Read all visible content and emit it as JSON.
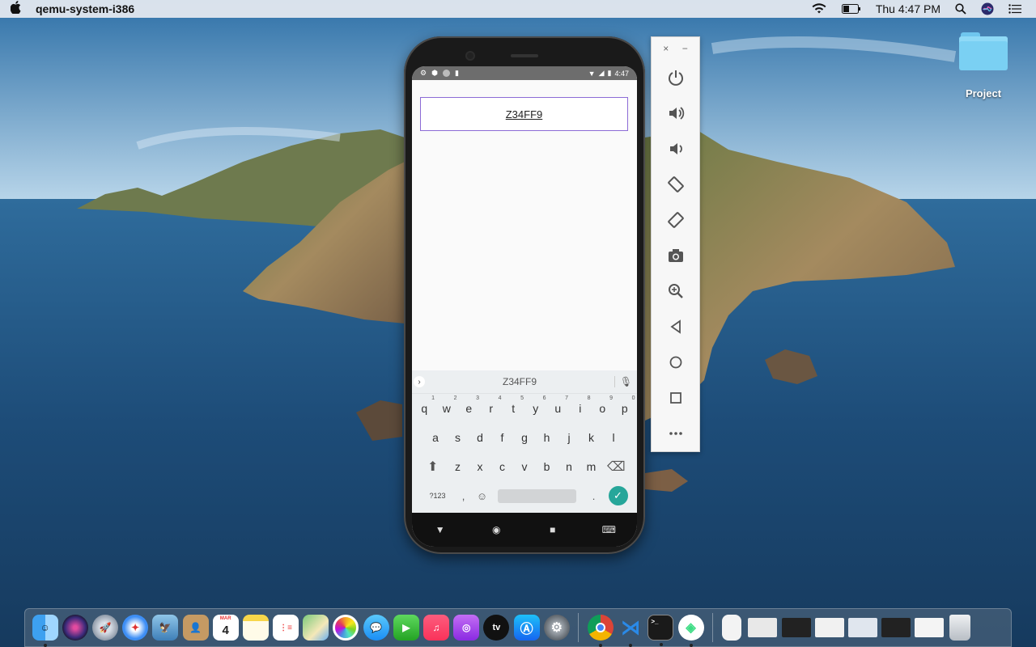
{
  "menubar": {
    "app_name": "qemu-system-i386",
    "clock": "Thu 4:47 PM",
    "icons": [
      "apple-icon",
      "wifi-icon",
      "battery-icon",
      "spotlight-search-icon",
      "siri-icon",
      "control-center-icon"
    ]
  },
  "desktop": {
    "folder_label": "Project"
  },
  "android": {
    "status_time": "4:47",
    "textbox_value": "Z34FF9",
    "suggestion": "Z34FF9",
    "keyboard": {
      "row1": [
        {
          "key": "q",
          "hint": "1"
        },
        {
          "key": "w",
          "hint": "2"
        },
        {
          "key": "e",
          "hint": "3"
        },
        {
          "key": "r",
          "hint": "4"
        },
        {
          "key": "t",
          "hint": "5"
        },
        {
          "key": "y",
          "hint": "6"
        },
        {
          "key": "u",
          "hint": "7"
        },
        {
          "key": "i",
          "hint": "8"
        },
        {
          "key": "o",
          "hint": "9"
        },
        {
          "key": "p",
          "hint": "0"
        }
      ],
      "row2": [
        "a",
        "s",
        "d",
        "f",
        "g",
        "h",
        "j",
        "k",
        "l"
      ],
      "row3": [
        "z",
        "x",
        "c",
        "v",
        "b",
        "n",
        "m"
      ],
      "symbols_label": "?123",
      "comma": ",",
      "period": "."
    },
    "navbar": {
      "back": "▼",
      "home": "◉",
      "recents": "■",
      "keyboard": "⌨"
    }
  },
  "emulator_toolbar": {
    "close": "×",
    "minimize": "−",
    "buttons": [
      "power",
      "volume-up",
      "volume-down",
      "rotate-left",
      "rotate-right",
      "screenshot",
      "zoom",
      "back",
      "home",
      "overview",
      "more"
    ]
  },
  "dock": {
    "calendar_month": "MAR",
    "calendar_day": "4",
    "apps": [
      "finder",
      "siri",
      "launchpad",
      "safari",
      "mail",
      "contacts",
      "calendar",
      "notes",
      "reminders",
      "maps",
      "photos",
      "messages",
      "facetime",
      "music",
      "podcasts",
      "tv",
      "app-store",
      "system-preferences",
      "chrome",
      "vscode",
      "terminal",
      "android-studio"
    ],
    "tv_label": "tv"
  },
  "colors": {
    "accent_purple": "#8c6bd6",
    "enter_teal": "#26a69a"
  }
}
